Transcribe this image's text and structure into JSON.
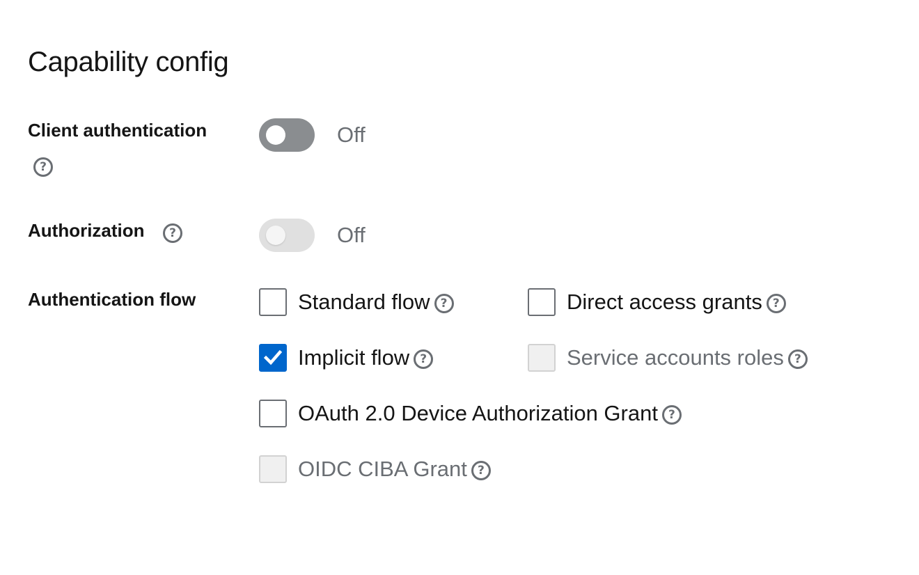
{
  "section": {
    "title": "Capability config"
  },
  "client_authentication": {
    "label": "Client authentication",
    "help_icon": "question-circle-icon",
    "state_text": "Off",
    "enabled": false
  },
  "authorization": {
    "label": "Authorization",
    "help_icon": "question-circle-icon",
    "state_text": "Off",
    "enabled": false,
    "disabled": true
  },
  "authentication_flow": {
    "label": "Authentication flow",
    "options": [
      {
        "label": "Standard flow",
        "checked": false,
        "disabled": false
      },
      {
        "label": "Direct access grants",
        "checked": false,
        "disabled": false
      },
      {
        "label": "Implicit flow",
        "checked": true,
        "disabled": false
      },
      {
        "label": "Service accounts roles",
        "checked": false,
        "disabled": true
      },
      {
        "label": "OAuth 2.0 Device Authorization Grant",
        "checked": false,
        "disabled": false
      },
      {
        "label": "OIDC CIBA Grant",
        "checked": false,
        "disabled": true
      }
    ]
  },
  "help_glyph": "?",
  "colors": {
    "accent": "#0066cc",
    "switch_off": "#8a8d90",
    "switch_disabled": "#e0e0e0",
    "muted_text": "#6a6e73"
  }
}
